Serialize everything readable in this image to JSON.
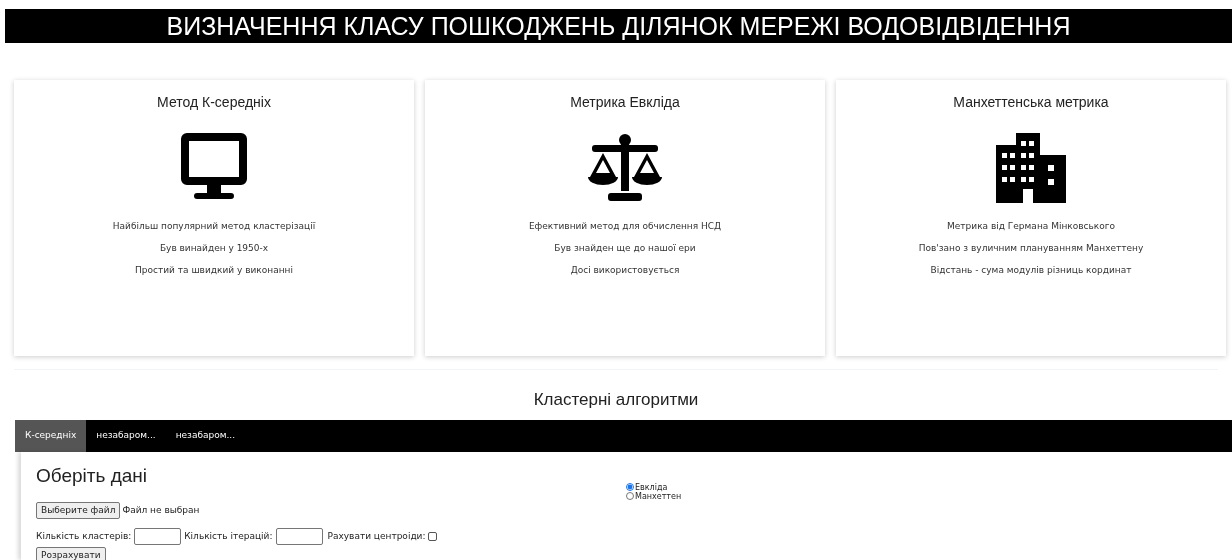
{
  "header": {
    "title": "ВИЗНАЧЕННЯ КЛАСУ ПОШКОДЖЕНЬ ДІЛЯНОК МЕРЕЖІ ВОДОВІДВІДЕННЯ"
  },
  "cards": [
    {
      "title": "Метод К-середніх",
      "kind": "monitor",
      "lines": [
        "Найбільш популярний метод кластерізації",
        "Був винайден у 1950-х",
        "Простий та швидкий у виконанні"
      ]
    },
    {
      "title": "Метрика Евкліда",
      "kind": "scale",
      "lines": [
        "Ефективний метод для обчислення НСД",
        "Був знайден ще до нашої ери",
        "Досі використовується"
      ]
    },
    {
      "title": "Манхеттенська метрика",
      "kind": "buildings",
      "lines": [
        "Метрика від Германа Мінковського",
        "Пов'зано з вуличним плануванням Манхеттену",
        "Відстань - сума модулів різниць кординат"
      ]
    }
  ],
  "section_title": "Кластерні алгоритми",
  "tabs": [
    {
      "label": "К-середніх",
      "selected": true
    },
    {
      "label": "незабаром...",
      "selected": false
    },
    {
      "label": "незабаром...",
      "selected": false
    }
  ],
  "panel": {
    "heading": "Оберіть дані",
    "file_button": "Выберите файл",
    "file_status": "Файл не выбран",
    "clusters_label": "Кількість кластерів:",
    "iterations_label": "Кількість ітерацій:",
    "centroids_label": "Рахувати центроіди:",
    "centroids_checked": false,
    "calculate_button": "Розрахувати",
    "metrics": [
      {
        "label": "Евкліда",
        "selected": true
      },
      {
        "label": "Манхеттен",
        "selected": false
      }
    ]
  }
}
